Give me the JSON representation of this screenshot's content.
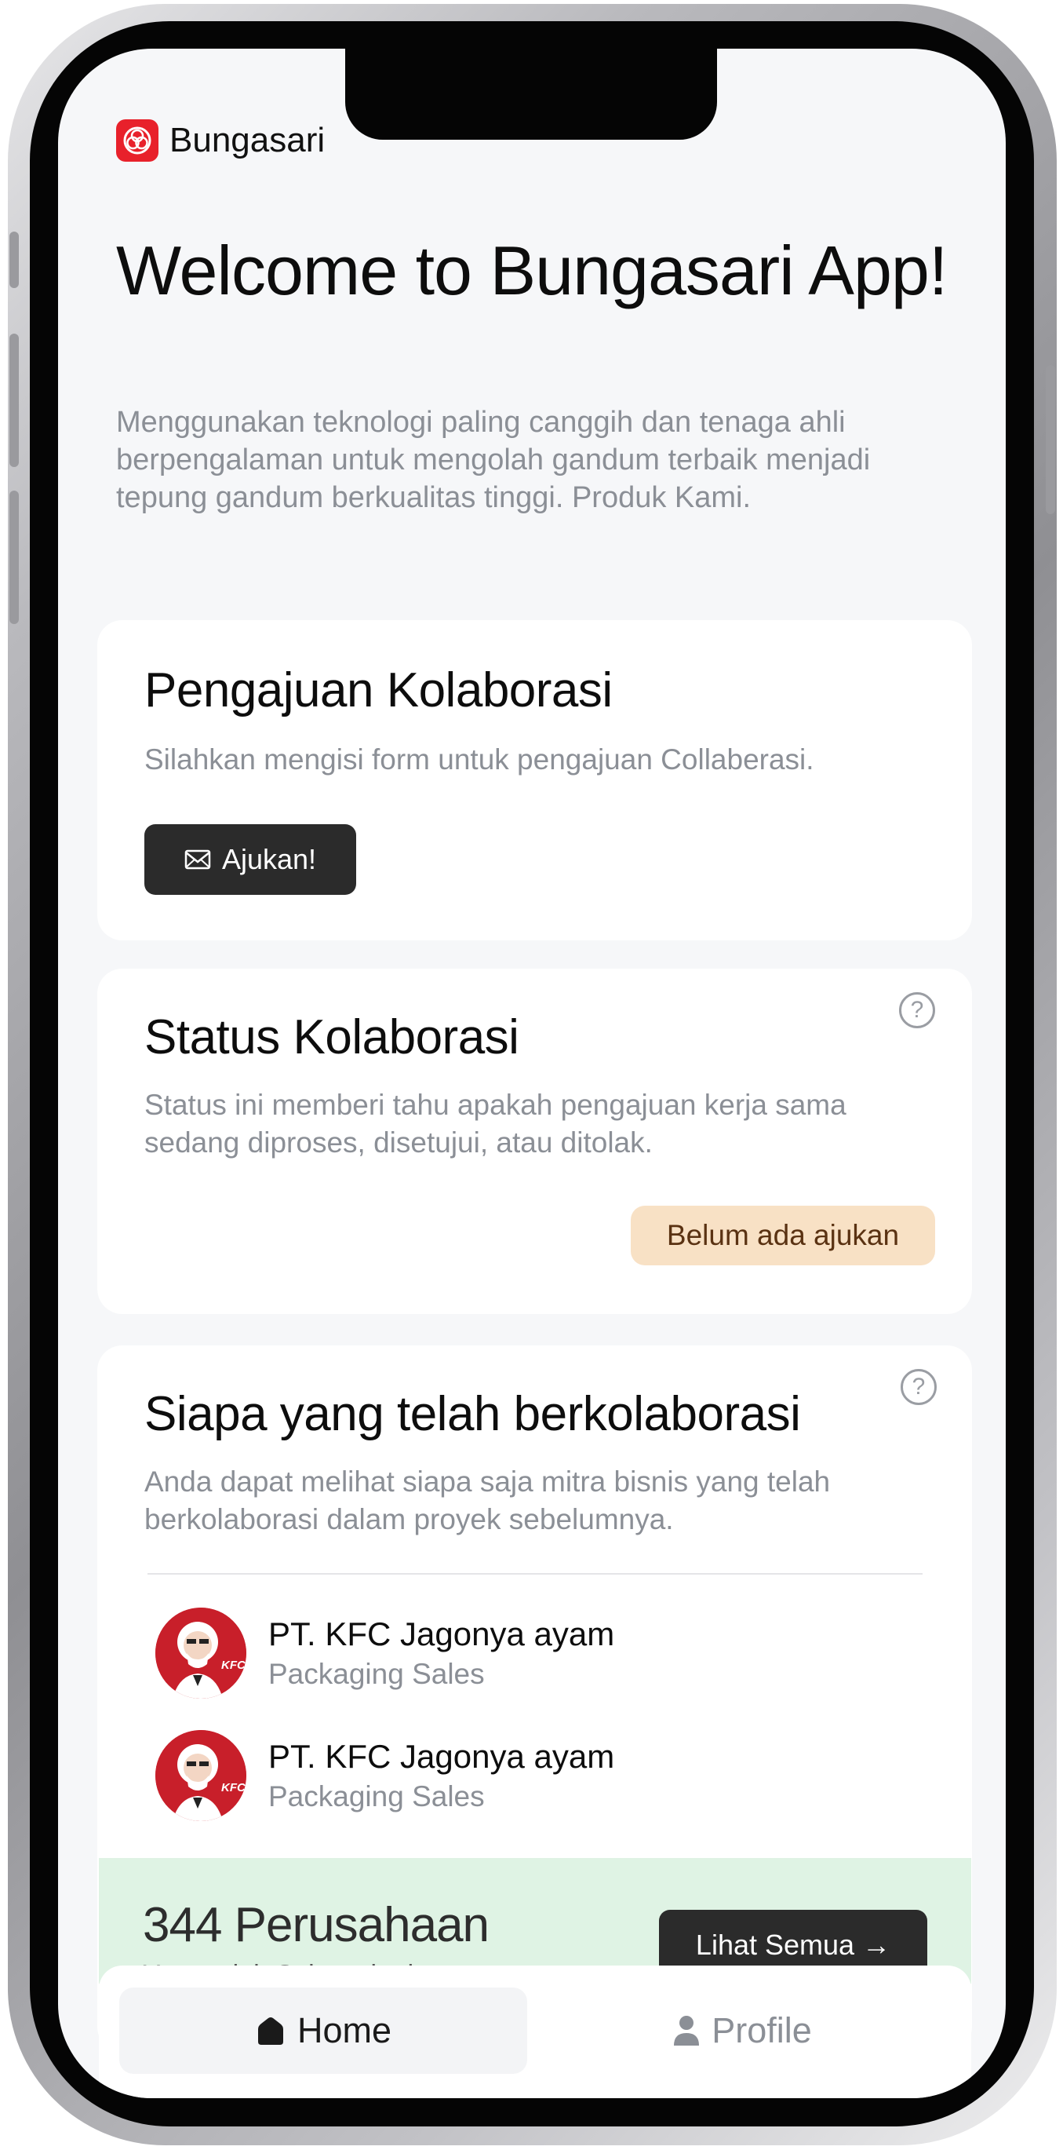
{
  "header": {
    "brand_name": "Bungasari",
    "brand_color": "#e8212b"
  },
  "hero": {
    "title": "Welcome to Bungasari App!",
    "description": "Menggunakan teknologi paling canggih dan tenaga ahli berpengalaman untuk mengolah gandum terbaik menjadi tepung gandum berkualitas tinggi. Produk Kami."
  },
  "collab_request": {
    "title": "Pengajuan Kolaborasi",
    "description": "Silahkan mengisi form untuk pengajuan Collaberasi.",
    "button_label": "Ajukan!",
    "button_icon": "envelope-icon"
  },
  "collab_status": {
    "title": "Status Kolaborasi",
    "description": "Status ini memberi tahu apakah pengajuan kerja sama sedang diproses, disetujui, atau ditolak.",
    "status_label": "Belum ada ajukan",
    "help_symbol": "?"
  },
  "partners": {
    "title": "Siapa yang telah berkolaborasi",
    "description": "Anda dapat melihat siapa saja mitra bisnis yang telah berkolaborasi dalam proyek sebelumnya.",
    "help_symbol": "?",
    "items": [
      {
        "name": "PT. KFC Jagonya ayam",
        "role": "Packaging Sales",
        "logo": "kfc-logo"
      },
      {
        "name": "PT. KFC Jagonya ayam",
        "role": "Packaging Sales",
        "logo": "kfc-logo"
      }
    ],
    "count_label": "344 Perusahaan",
    "count_sub": "Yang telah Sukses kerja sama",
    "see_all_label": "Lihat Semua →"
  },
  "tabbar": {
    "tabs": [
      {
        "label": "Home",
        "icon": "home-icon",
        "active": true
      },
      {
        "label": "Profile",
        "icon": "user-icon",
        "active": false
      }
    ]
  }
}
